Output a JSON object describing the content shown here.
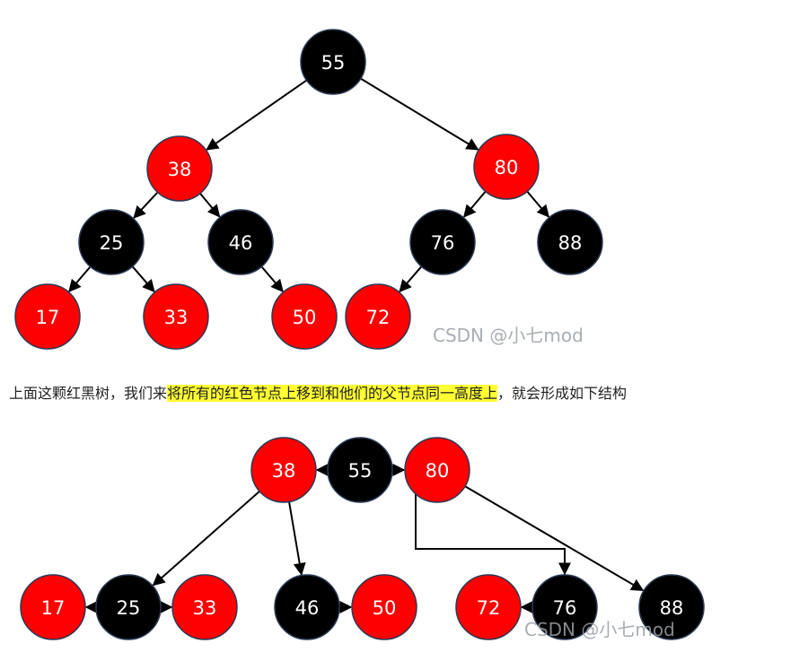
{
  "colors": {
    "red_node": "#ff0000",
    "black_node": "#000000",
    "node_border": "#2b3a55",
    "node_text": "#ffffff",
    "edge": "#000000",
    "highlight": "#ffff33",
    "watermark": "#9aa0a6",
    "caption_text": "#222222"
  },
  "caption": {
    "prefix": "上面这颗红黑树，我们来",
    "highlighted": "将所有的红色节点上移到和他们的父节点同一高度上",
    "suffix": "，就会形成如下结构"
  },
  "watermark": "CSDN @小七mod",
  "tree1": {
    "nodes": [
      {
        "id": "t1-55",
        "label": "55",
        "color": "black"
      },
      {
        "id": "t1-38",
        "label": "38",
        "color": "red"
      },
      {
        "id": "t1-80",
        "label": "80",
        "color": "red"
      },
      {
        "id": "t1-25",
        "label": "25",
        "color": "black"
      },
      {
        "id": "t1-46",
        "label": "46",
        "color": "black"
      },
      {
        "id": "t1-76",
        "label": "76",
        "color": "black"
      },
      {
        "id": "t1-88",
        "label": "88",
        "color": "black"
      },
      {
        "id": "t1-17",
        "label": "17",
        "color": "red"
      },
      {
        "id": "t1-33",
        "label": "33",
        "color": "red"
      },
      {
        "id": "t1-50",
        "label": "50",
        "color": "red"
      },
      {
        "id": "t1-72",
        "label": "72",
        "color": "red"
      }
    ],
    "edges": [
      {
        "from": "t1-55",
        "to": "t1-38"
      },
      {
        "from": "t1-55",
        "to": "t1-80"
      },
      {
        "from": "t1-38",
        "to": "t1-25"
      },
      {
        "from": "t1-38",
        "to": "t1-46"
      },
      {
        "from": "t1-80",
        "to": "t1-76"
      },
      {
        "from": "t1-80",
        "to": "t1-88"
      },
      {
        "from": "t1-25",
        "to": "t1-17"
      },
      {
        "from": "t1-25",
        "to": "t1-33"
      },
      {
        "from": "t1-46",
        "to": "t1-50"
      },
      {
        "from": "t1-76",
        "to": "t1-72"
      }
    ]
  },
  "tree2": {
    "nodes": [
      {
        "id": "t2-38",
        "label": "38",
        "color": "red"
      },
      {
        "id": "t2-55",
        "label": "55",
        "color": "black"
      },
      {
        "id": "t2-80",
        "label": "80",
        "color": "red"
      },
      {
        "id": "t2-17",
        "label": "17",
        "color": "red"
      },
      {
        "id": "t2-25",
        "label": "25",
        "color": "black"
      },
      {
        "id": "t2-33",
        "label": "33",
        "color": "red"
      },
      {
        "id": "t2-46",
        "label": "46",
        "color": "black"
      },
      {
        "id": "t2-50",
        "label": "50",
        "color": "red"
      },
      {
        "id": "t2-72",
        "label": "72",
        "color": "red"
      },
      {
        "id": "t2-76",
        "label": "76",
        "color": "black"
      },
      {
        "id": "t2-88",
        "label": "88",
        "color": "black"
      }
    ],
    "edges": [
      {
        "from": "t2-55",
        "to": "t2-38"
      },
      {
        "from": "t2-55",
        "to": "t2-80"
      },
      {
        "from": "t2-38",
        "to": "t2-25"
      },
      {
        "from": "t2-38",
        "to": "t2-46"
      },
      {
        "from": "t2-80",
        "to": "t2-76",
        "routing": "elbow"
      },
      {
        "from": "t2-80",
        "to": "t2-88"
      },
      {
        "from": "t2-25",
        "to": "t2-17"
      },
      {
        "from": "t2-25",
        "to": "t2-33"
      },
      {
        "from": "t2-46",
        "to": "t2-50"
      },
      {
        "from": "t2-76",
        "to": "t2-72"
      }
    ]
  }
}
